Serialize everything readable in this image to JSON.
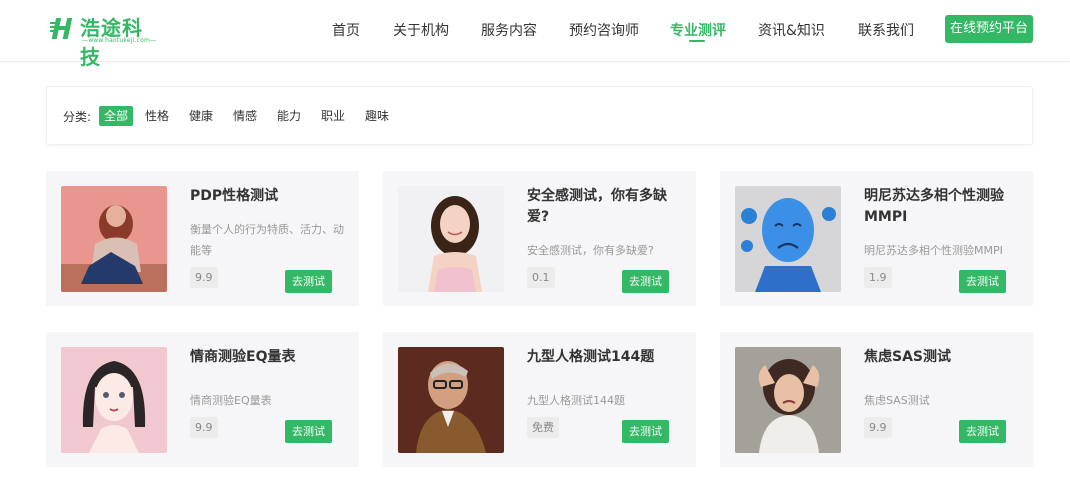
{
  "header": {
    "logo_text": "浩途科技",
    "logo_sub": "—www.haotukeji.com—",
    "nav": [
      "首页",
      "关于机构",
      "服务内容",
      "预约咨询师",
      "专业测评",
      "资讯&知识",
      "联系我们"
    ],
    "active_nav": "专业测评",
    "cta": "在线预约平台"
  },
  "filter": {
    "label": "分类:",
    "chips": [
      "全部",
      "性格",
      "健康",
      "情感",
      "能力",
      "职业",
      "趣味"
    ],
    "active": "全部"
  },
  "cards": [
    {
      "title": "PDP性格测试",
      "desc": "衡量个人的行为特质、活力、动能等",
      "score": "9.9",
      "button": "去测试"
    },
    {
      "title": "安全感测试，你有多缺爱?",
      "desc": "安全感测试，你有多缺爱?",
      "score": "0.1",
      "button": "去测试"
    },
    {
      "title": "明尼苏达多相个性测验MMPI",
      "desc": "明尼苏达多相个性测验MMPI",
      "score": "1.9",
      "button": "去测试"
    },
    {
      "title": "情商测验EQ量表",
      "desc": "情商测验EQ量表",
      "score": "9.9",
      "button": "去测试"
    },
    {
      "title": "九型人格测试144题",
      "desc": "九型人格测试144题",
      "score": "免费",
      "button": "去测试"
    },
    {
      "title": "焦虑SAS测试",
      "desc": "焦虑SAS测试",
      "score": "9.9",
      "button": "去测试"
    }
  ],
  "colors": {
    "accent": "#35b866",
    "card_bg": "#f6f6f8"
  }
}
